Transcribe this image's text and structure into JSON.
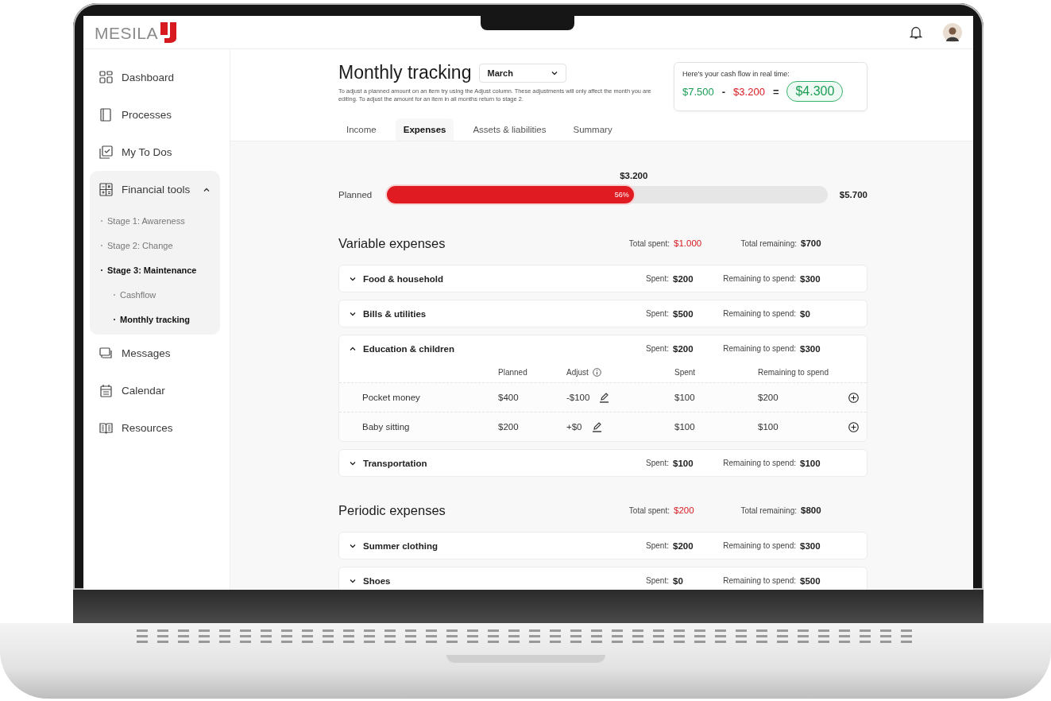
{
  "topbar": {
    "logo": "MESILA"
  },
  "sidebar": {
    "items": [
      {
        "label": "Dashboard",
        "selected": false
      },
      {
        "label": "Processes",
        "selected": false
      },
      {
        "label": "My To Dos",
        "selected": false
      },
      {
        "label": "Financial tools",
        "selected": false,
        "expanded": true,
        "children": [
          {
            "label": "Stage 1: Awareness",
            "selected": false
          },
          {
            "label": "Stage 2: Change",
            "selected": false
          },
          {
            "label": "Stage 3: Maintenance",
            "selected": true,
            "children": [
              {
                "label": "Cashflow",
                "selected": false
              },
              {
                "label": "Monthly tracking",
                "selected": true
              }
            ]
          }
        ]
      },
      {
        "label": "Messages",
        "selected": false
      },
      {
        "label": "Calendar",
        "selected": false
      },
      {
        "label": "Resources",
        "selected": false
      }
    ]
  },
  "header": {
    "title": "Monthly tracking",
    "month": "March",
    "description": "To adjust a planned amount on an item try using the Adjust column. These adjustments will only affect the month you are editing. To adjust the amount for an item in all months return to stage 2.",
    "tabs": [
      {
        "label": "Income",
        "selected": false
      },
      {
        "label": "Expenses",
        "selected": true
      },
      {
        "label": "Assets & liabilities",
        "selected": false
      },
      {
        "label": "Summary",
        "selected": false
      }
    ],
    "cashflow": {
      "label": "Here's your cash flow in real time:",
      "income": "$7.500",
      "minus": "-",
      "expenses": "$3.200",
      "equals": "=",
      "result": "$4.300"
    }
  },
  "progress": {
    "label": "Planned",
    "spent": "$3.200",
    "level": 0.56,
    "percent": "56%",
    "total": "$5.700"
  },
  "sections": [
    {
      "title": "Variable expenses",
      "total_spent_label": "Total spent:",
      "total_spent": "$1.000",
      "total_remaining_label": "Total remaining:",
      "total_remaining": "$700",
      "categories": [
        {
          "name": "Food & household",
          "expanded": false,
          "spent_label": "Spent:",
          "spent": "$200",
          "remaining_label": "Remaining to spend:",
          "remaining": "$300"
        },
        {
          "name": "Bills & utilities",
          "expanded": false,
          "spent_label": "Spent:",
          "spent": "$500",
          "remaining_label": "Remaining to spend:",
          "remaining": "$0"
        },
        {
          "name": "Education & children",
          "expanded": true,
          "spent_label": "Spent:",
          "spent": "$200",
          "remaining_label": "Remaining to spend:",
          "remaining": "$300",
          "columns": [
            "Planned",
            "Adjust",
            "Spent",
            "Remaining to spend"
          ],
          "items": [
            {
              "name": "Pocket money",
              "planned": "$400",
              "adjust": "-$100",
              "spent": "$100",
              "remaining": "$200"
            },
            {
              "name": "Baby sitting",
              "planned": "$200",
              "adjust": "+$0",
              "spent": "$100",
              "remaining": "$100"
            }
          ]
        },
        {
          "name": "Transportation",
          "expanded": false,
          "spent_label": "Spent:",
          "spent": "$100",
          "remaining_label": "Remaining to spend:",
          "remaining": "$100"
        }
      ]
    },
    {
      "title": "Periodic expenses",
      "total_spent_label": "Total spent:",
      "total_spent": "$200",
      "total_remaining_label": "Total remaining:",
      "total_remaining": "$800",
      "categories": [
        {
          "name": "Summer clothing",
          "expanded": false,
          "spent_label": "Spent:",
          "spent": "$200",
          "remaining_label": "Remaining to spend:",
          "remaining": "$300"
        },
        {
          "name": "Shoes",
          "expanded": false,
          "spent_label": "Spent:",
          "spent": "$0",
          "remaining_label": "Remaining to spend:",
          "remaining": "$500"
        }
      ]
    }
  ]
}
